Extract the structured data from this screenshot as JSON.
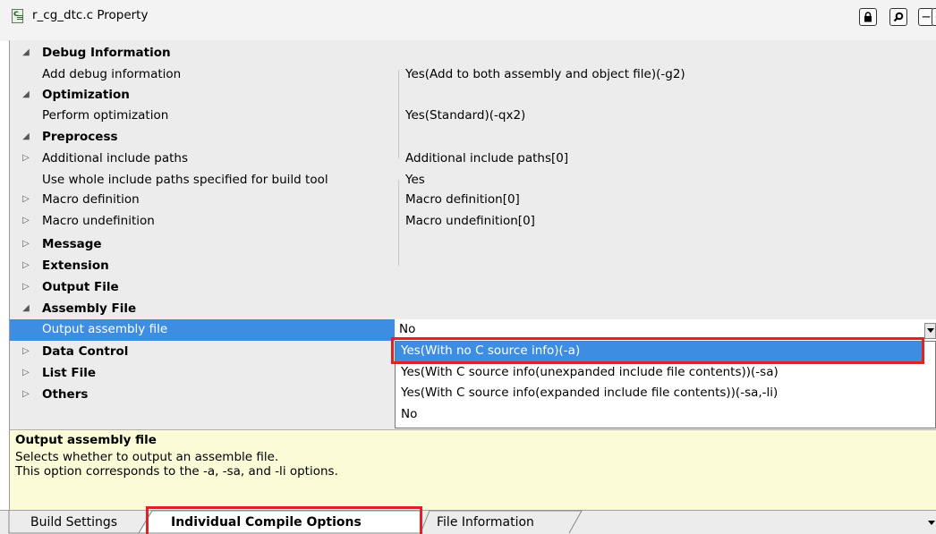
{
  "window": {
    "title": "r_cg_dtc.c Property"
  },
  "toolbar": {
    "lock_icon": "lock-icon",
    "search_icon": "search-icon",
    "collapse_label": "−",
    "expand_label": "+"
  },
  "categories": {
    "debug": "Debug Information",
    "optimization": "Optimization",
    "preprocess": "Preprocess",
    "message": "Message",
    "extension": "Extension",
    "output_file": "Output File",
    "assembly_file": "Assembly File",
    "data_control": "Data Control",
    "list_file": "List File",
    "others": "Others"
  },
  "properties": {
    "add_debug": {
      "name": "Add debug information",
      "value": "Yes(Add to both assembly and object file)(-g2)"
    },
    "perform_opt": {
      "name": "Perform optimization",
      "value": "Yes(Standard)(-qx2)"
    },
    "include_paths": {
      "name": "Additional include paths",
      "value": "Additional include paths[0]"
    },
    "whole_include": {
      "name": "Use whole include paths specified for build tool",
      "value": "Yes"
    },
    "macro_def": {
      "name": "Macro definition",
      "value": "Macro definition[0]"
    },
    "macro_undef": {
      "name": "Macro undefinition",
      "value": "Macro undefinition[0]"
    },
    "output_asm": {
      "name": "Output assembly file",
      "value": "No"
    }
  },
  "dropdown": {
    "options": [
      "Yes(With no C source info)(-a)",
      "Yes(With C source info(unexpanded include file contents))(-sa)",
      "Yes(With C source info(expanded include file contents))(-sa,-li)",
      "No"
    ],
    "highlighted_index": 0
  },
  "description": {
    "title": "Output assembly file",
    "line1": "Selects whether to output an assemble file.",
    "line2": "This option corresponds to the -a, -sa, and -li options."
  },
  "tabs": {
    "build_settings": "Build Settings",
    "individual_compile": "Individual Compile Options",
    "file_info": "File Information"
  },
  "colors": {
    "selection": "#3d8ee2",
    "highlight_box": "#e0202a",
    "description_bg": "#fbfbd8"
  }
}
